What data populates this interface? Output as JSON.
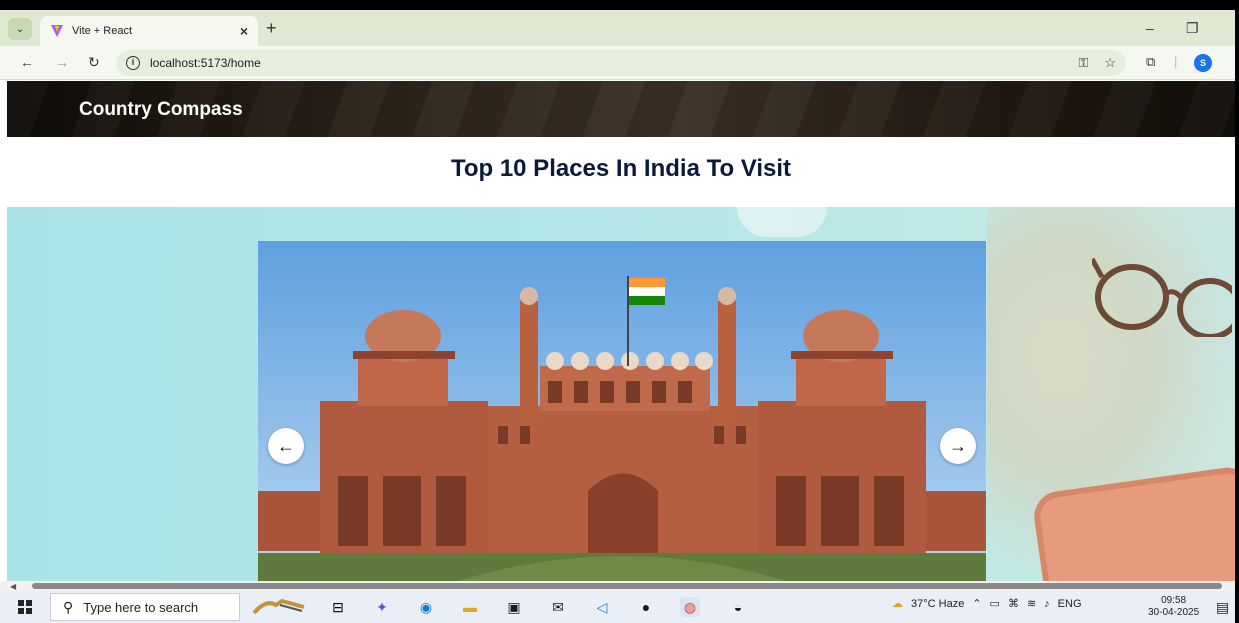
{
  "browser": {
    "tab_title": "Vite + React",
    "tab_close": "×",
    "new_tab": "+",
    "url": "localhost:5173/home",
    "profile_initial": "S",
    "minimize": "–",
    "restore": "❐"
  },
  "navbar": {
    "brand": "Country Compass"
  },
  "page": {
    "heading": "Top 10 Places In India To Visit",
    "prev_arrow": "←",
    "next_arrow": "→"
  },
  "taskbar": {
    "search_placeholder": "Type here to search",
    "weather": "37°C  Haze",
    "language": "ENG",
    "time": "09:58",
    "date": "30-04-2025"
  },
  "colors": {
    "navbar_bg": "#2b2218",
    "heading": "#0c1a3a",
    "hero_bg": "#a9e3e7",
    "fort": "#b85a3e"
  }
}
